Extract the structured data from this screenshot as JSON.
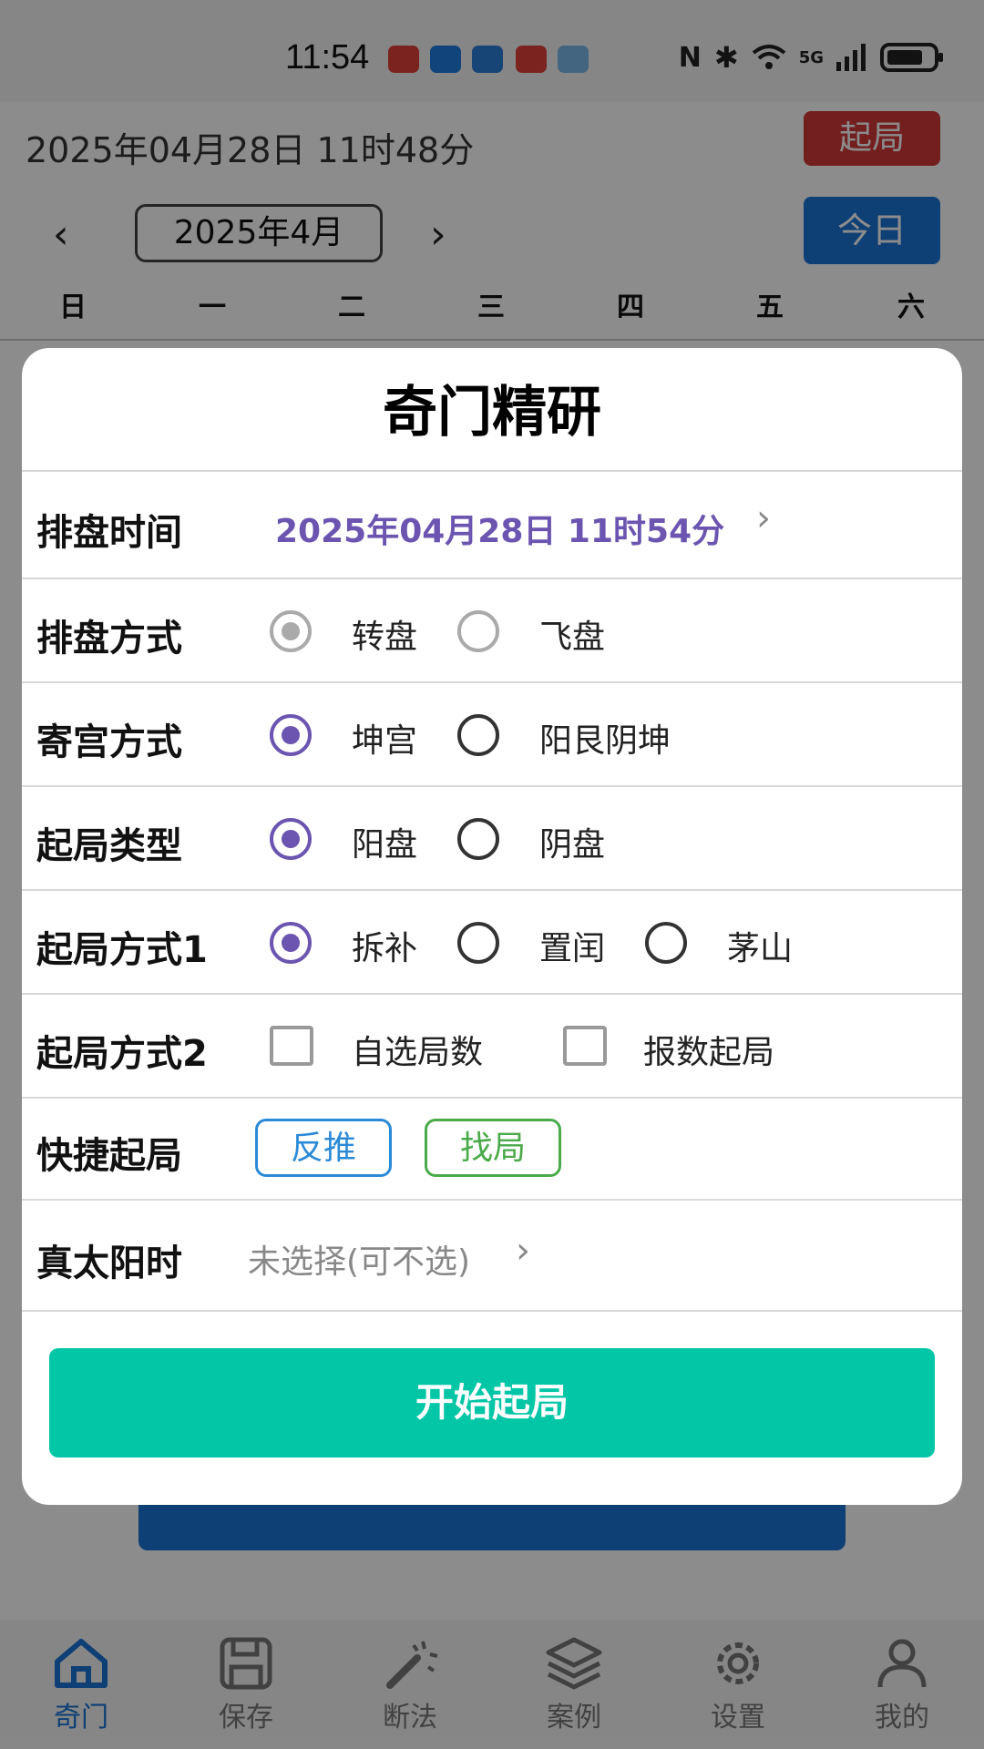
{
  "status_bar": {
    "time": "11:54",
    "signal": "5G",
    "colors": {
      "notif_red": "#e0423a",
      "notif_blue": "#1e7ce0"
    }
  },
  "background": {
    "top_date": "2025年04月28日 11时48分",
    "qiju_label": "起局",
    "month": "2025年4月",
    "today_label": "今日",
    "prev_icon": "chevron-left-icon",
    "next_icon": "chevron-right-icon",
    "weekdays": [
      "日",
      "一",
      "二",
      "三",
      "四",
      "五",
      "六"
    ]
  },
  "dialog": {
    "title": "奇门精研",
    "time_row": {
      "label": "排盘时间",
      "value": "2025年04月28日 11时54分"
    },
    "method_row": {
      "label": "排盘方式",
      "options": [
        "转盘",
        "飞盘"
      ],
      "selected": "转盘"
    },
    "palace_row": {
      "label": "寄宫方式",
      "options": [
        "坤宫",
        "阳艮阴坤"
      ],
      "selected": "坤宫"
    },
    "type_row": {
      "label": "起局类型",
      "options": [
        "阳盘",
        "阴盘"
      ],
      "selected": "阳盘"
    },
    "way1_row": {
      "label": "起局方式1",
      "options": [
        "拆补",
        "置闰",
        "茅山"
      ],
      "selected": "拆补"
    },
    "way2_row": {
      "label": "起局方式2",
      "options": [
        "自选局数",
        "报数起局"
      ]
    },
    "quick_row": {
      "label": "快捷起局",
      "buttons": [
        "反推",
        "找局"
      ]
    },
    "solar_row": {
      "label": "真太阳时",
      "value": "未选择(可不选)"
    },
    "start_button": "开始起局",
    "colors": {
      "accent": "#6b55b0",
      "start": "#03c6a6",
      "fantui": "#2b8ad6",
      "zhaoju": "#4aaa4a"
    }
  },
  "bottom_nav": {
    "items": [
      {
        "label": "奇门",
        "icon": "home-icon",
        "active": true
      },
      {
        "label": "保存",
        "icon": "save-icon",
        "active": false
      },
      {
        "label": "断法",
        "icon": "magic-wand-icon",
        "active": false
      },
      {
        "label": "案例",
        "icon": "layers-icon",
        "active": false
      },
      {
        "label": "设置",
        "icon": "gear-icon",
        "active": false
      },
      {
        "label": "我的",
        "icon": "person-icon",
        "active": false
      }
    ]
  }
}
